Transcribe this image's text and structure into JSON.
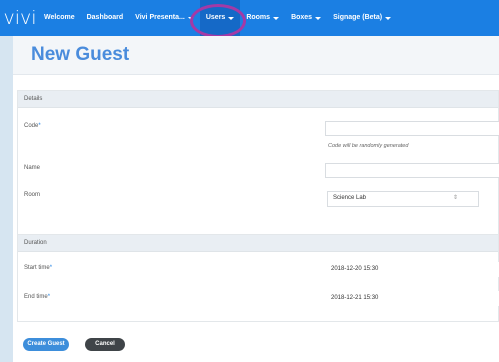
{
  "brand": {
    "logo_text": "vivi"
  },
  "nav": {
    "items": [
      {
        "label": "Welcome",
        "dropdown": false
      },
      {
        "label": "Dashboard",
        "dropdown": false
      },
      {
        "label": "Vivi Presenta...",
        "dropdown": true
      },
      {
        "label": "Users",
        "dropdown": true,
        "active": true
      },
      {
        "label": "Rooms",
        "dropdown": true
      },
      {
        "label": "Boxes",
        "dropdown": true
      },
      {
        "label": "Signage (Beta)",
        "dropdown": true
      }
    ]
  },
  "page": {
    "title": "New Guest"
  },
  "details": {
    "heading": "Details",
    "code_label": "Code",
    "required_mark": "*",
    "code_hint": "Code will be randomly generated",
    "name_label": "Name",
    "room_label": "Room",
    "room_value": "Science Lab",
    "room_caret": "⇕"
  },
  "duration": {
    "heading": "Duration",
    "start_label": "Start time",
    "start_value": "2018-12-20 15:30",
    "end_label": "End time",
    "end_value": "2018-12-21 15:30"
  },
  "actions": {
    "create_label": "Create Guest",
    "cancel_label": "Cancel"
  },
  "colors": {
    "navbar": "#1b7fe3",
    "title": "#4a8cdc",
    "annotation_ring": "#a33aa6"
  }
}
